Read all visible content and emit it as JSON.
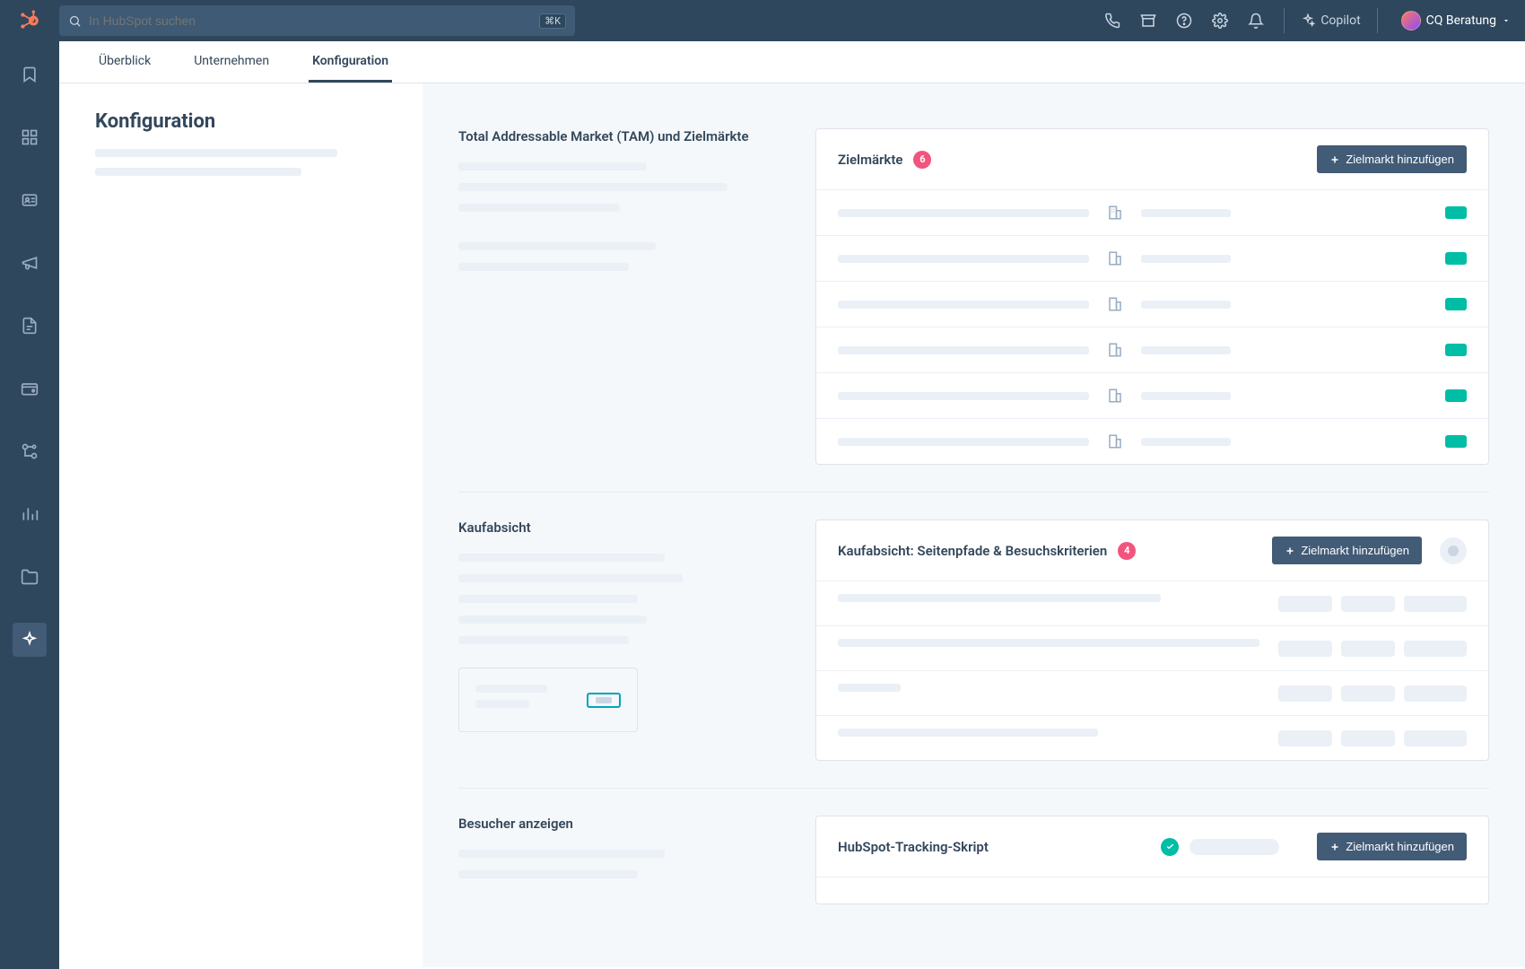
{
  "search": {
    "placeholder": "In HubSpot suchen",
    "kbd": "⌘K"
  },
  "copilot_label": "Copilot",
  "user_label": "CQ Beratung",
  "tabs": {
    "overview": "Überblick",
    "companies": "Unternehmen",
    "config": "Konfiguration"
  },
  "sidepane": {
    "title": "Konfiguration"
  },
  "sections": {
    "tam": {
      "title": "Total Addressable Market (TAM) und Zielmärkte"
    },
    "intent": {
      "title": "Kaufabsicht"
    },
    "visitors": {
      "title": "Besucher anzeigen"
    }
  },
  "panels": {
    "targets": {
      "title": "Zielmärkte",
      "count": "6",
      "button": "Zielmarkt hinzufügen"
    },
    "intent": {
      "title": "Kaufabsicht: Seitenpfade & Besuchskriterien",
      "count": "4",
      "button": "Zielmarkt hinzufügen"
    },
    "tracking": {
      "title": "HubSpot-Tracking-Skript",
      "button": "Zielmarkt hinzufügen"
    }
  }
}
